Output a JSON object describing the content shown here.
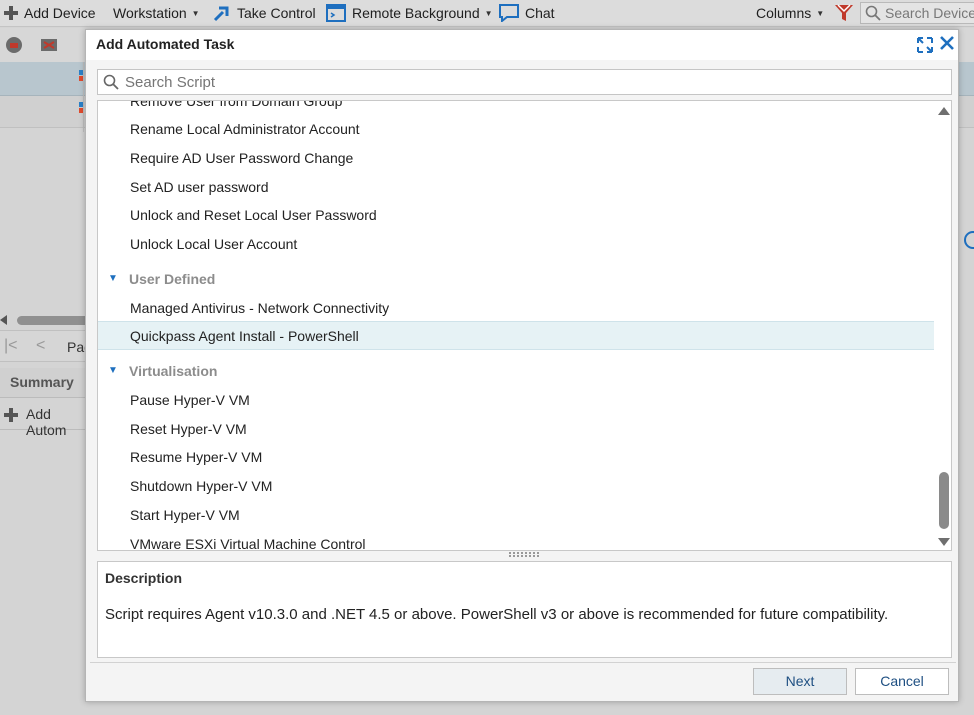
{
  "toolbar": {
    "add_device": "Add Device",
    "workstation": "Workstation",
    "take_control": "Take Control",
    "remote_background": "Remote Background",
    "chat": "Chat",
    "columns": "Columns",
    "search_placeholder": "Search Devices"
  },
  "background": {
    "pager_label": "Pag",
    "summary_tab": "Summary",
    "add_automated": "Add Autom"
  },
  "dialog": {
    "title": "Add Automated Task",
    "search_placeholder": "Search Script",
    "items": {
      "remove_user_domain_group": "Remove User from Domain Group",
      "rename_local_admin": "Rename Local Administrator Account",
      "require_ad_pw_change": "Require AD User Password Change",
      "set_ad_pw": "Set AD user password",
      "unlock_reset_local_pw": "Unlock and Reset Local User Password",
      "unlock_local_account": "Unlock Local User Account"
    },
    "group_user_defined": {
      "label": "User Defined",
      "items": {
        "managed_av": "Managed Antivirus - Network Connectivity",
        "quickpass": "Quickpass Agent Install - PowerShell"
      }
    },
    "group_virtualisation": {
      "label": "Virtualisation",
      "items": {
        "pause": "Pause Hyper-V VM",
        "reset": "Reset Hyper-V VM",
        "resume": "Resume Hyper-V VM",
        "shutdown": "Shutdown Hyper-V VM",
        "start": "Start Hyper-V VM",
        "vmware": "VMware ESXi Virtual Machine Control"
      }
    },
    "description": {
      "title": "Description",
      "text": "Script requires Agent v10.3.0 and .NET 4.5 or above. PowerShell v3 or above is recommended for future compatibility."
    },
    "buttons": {
      "next": "Next",
      "cancel": "Cancel"
    }
  },
  "colors": {
    "accent": "#1e6fbf",
    "selected_row": "#e6f2f5",
    "group_header": "#8c8c8c"
  }
}
